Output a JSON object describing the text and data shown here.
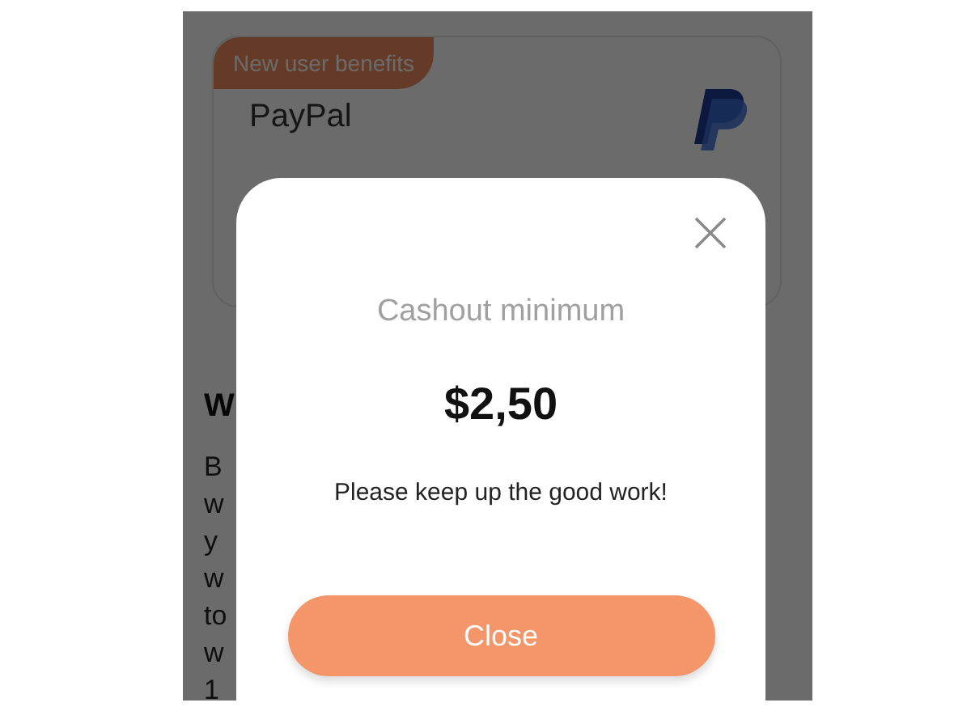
{
  "background": {
    "card": {
      "badge": "New user benefits",
      "method": "PayPal"
    },
    "heading": "W",
    "paragraph_lines": [
      "B",
      "w",
      "y",
      "w",
      "to",
      "w",
      "1"
    ]
  },
  "dialog": {
    "title": "Cashout minimum",
    "amount": "$2,50",
    "message": "Please keep up the good work!",
    "button": "Close"
  }
}
